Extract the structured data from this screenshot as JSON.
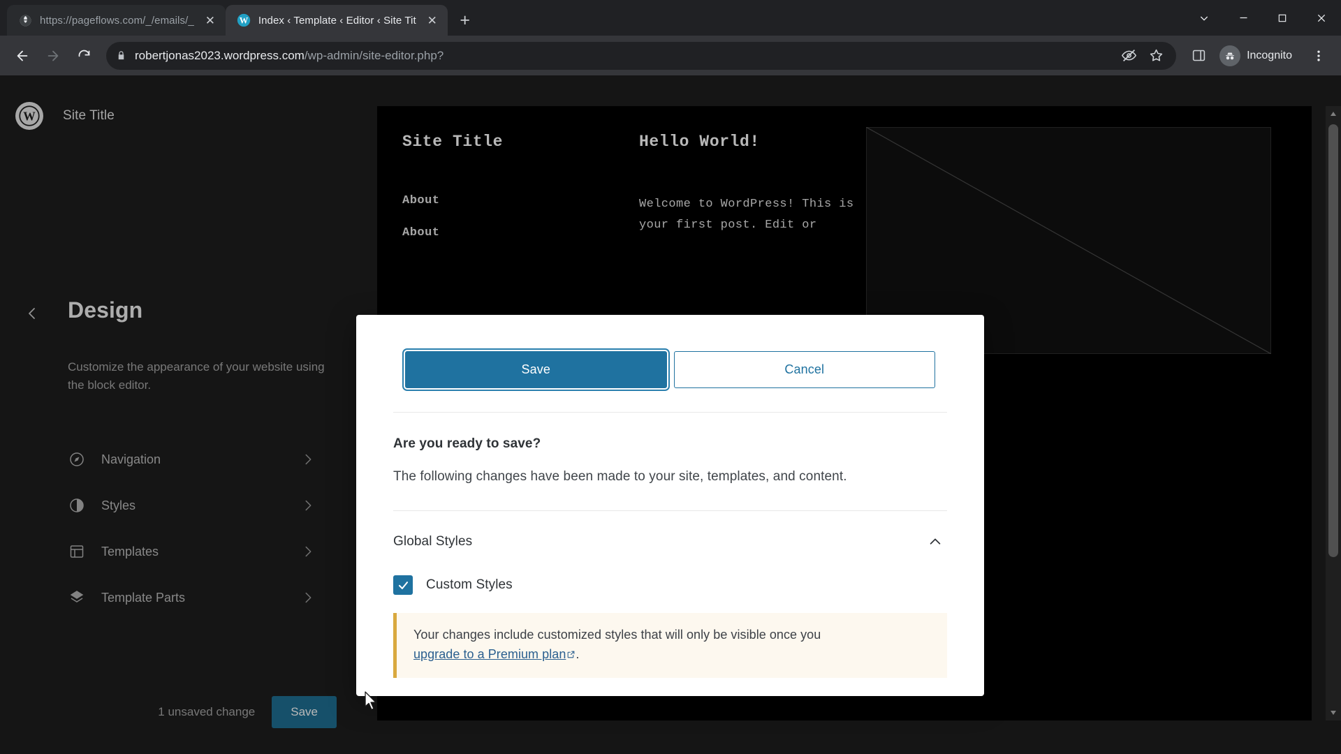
{
  "browser": {
    "tabs": [
      {
        "title": "https://pageflows.com/_/emails/_",
        "favicon": "globe-icon",
        "active": false
      },
      {
        "title": "Index ‹ Template ‹ Editor ‹ Site Tit",
        "favicon": "wordpress-icon",
        "active": true
      }
    ],
    "new_tab_label": "+",
    "close_label": "✕",
    "window_controls": {
      "minimize": "–",
      "maximize": "□",
      "close": "✕",
      "chevron": "⌄"
    },
    "omnibox": {
      "domain": "robertjonas2023.wordpress.com",
      "path": "/wp-admin/site-editor.php?",
      "lock_icon": "lock-icon"
    },
    "profile": {
      "label": "Incognito",
      "icon": "incognito-icon"
    },
    "icons": {
      "back": "back-arrow-icon",
      "forward": "forward-arrow-icon",
      "reload": "reload-icon",
      "tracking": "eye-off-icon",
      "bookmark": "star-icon",
      "sidepanel": "side-panel-icon",
      "menu": "three-dot-menu-icon"
    }
  },
  "sidebar": {
    "site_title": "Site Title",
    "logo": "wordpress-logo-icon",
    "back_icon": "chevron-left-icon",
    "page_title": "Design",
    "description": "Customize the appearance of your website using the block editor.",
    "items": [
      {
        "label": "Navigation",
        "icon": "compass-icon"
      },
      {
        "label": "Styles",
        "icon": "half-circle-icon"
      },
      {
        "label": "Templates",
        "icon": "layout-icon"
      },
      {
        "label": "Template Parts",
        "icon": "layers-icon"
      }
    ],
    "chevron_icon": "chevron-right-icon",
    "unsaved_label": "1 unsaved change",
    "save_label": "Save"
  },
  "canvas": {
    "site_title": "Site Title",
    "nav_items": [
      "About",
      "About"
    ],
    "post_title": "Hello World!",
    "post_body": "Welcome to WordPress! This is your first post. Edit or",
    "scrollbar": {
      "up": "▲",
      "down": "▼"
    }
  },
  "modal": {
    "save_label": "Save",
    "cancel_label": "Cancel",
    "question": "Are you ready to save?",
    "subtext": "The following changes have been made to your site, templates, and content.",
    "panel": {
      "title": "Global Styles",
      "toggle_icon": "chevron-up-icon",
      "expanded": true,
      "checkbox": {
        "label": "Custom Styles",
        "checked": true,
        "color": "#1f72a0"
      },
      "notice": {
        "text_before": "Your changes include customized styles that will only be visible once you ",
        "link_text": "upgrade to a Premium plan",
        "link_icon": "external-link-icon",
        "text_after": ".",
        "accent_color": "#d9a93f",
        "background_color": "#fdf8ef"
      }
    }
  },
  "colors": {
    "primary": "#1f72a0",
    "browser_chrome": "#202124",
    "toolbar": "#35363a",
    "editor_bg": "#1e1e1e"
  }
}
